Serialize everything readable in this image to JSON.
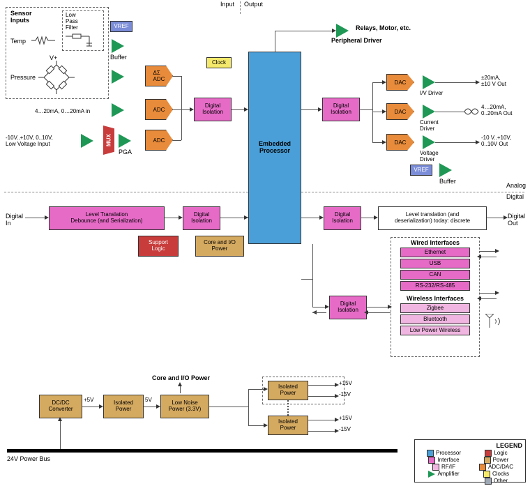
{
  "headings": {
    "input": "Input",
    "output": "Output",
    "sensor_inputs": "Sensor\nInputs",
    "low_pass_filter": "Low\nPass\nFilter",
    "temp": "Temp",
    "pressure": "Pressure",
    "vplus": "V+",
    "analog": "Analog",
    "digital": "Digital",
    "wired": "Wired Interfaces",
    "wireless": "Wireless Interfaces",
    "legend": "LEGEND"
  },
  "blocks": {
    "vref": "VREF",
    "buffer": "Buffer",
    "ds_adc": "ΔΣ\nADC",
    "adc": "ADC",
    "mux": "MUX",
    "pga": "PGA",
    "clock": "Clock",
    "digital_isolation": "Digital\nIsolation",
    "embedded_processor": "Embedded\nProcessor",
    "dac": "DAC",
    "iv_driver": "I/V Driver",
    "current_driver": "Current\nDriver",
    "voltage_driver": "Voltage\nDriver",
    "relays": "Relays, Motor, etc.",
    "peripheral_driver": "Peripheral Driver",
    "level_trans_in": "Level Translation\nDebounce (and Serialization)",
    "level_trans_out": "Level translation (and\ndeserialization) today: discrete",
    "support_logic": "Support\nLogic",
    "core_io_power": "Core and I/O\nPower",
    "ethernet": "Ethernet",
    "usb": "USB",
    "can": "CAN",
    "rs": "RS-232/RS-485",
    "zigbee": "Zigbee",
    "bluetooth": "Bluetooth",
    "low_power_wireless": "Low Power Wireless",
    "dcdc": "DC/DC\nConverter",
    "isolated_power": "Isolated\nPower",
    "low_noise_power": "Low Noise\nPower (3.3V)",
    "core_io_power_lbl": "Core and I/O Power"
  },
  "io_labels": {
    "input_range1": "4…20mA, 0…20mA in",
    "input_range2": "-10V..+10V, 0..10V,\nLow Voltage Input",
    "digital_in": "Digital\nIn",
    "digital_out": "Digital\nOut",
    "out_20ma": "±20mA,\n±10 V Out",
    "out_420ma": "4…20mA,\n0..20mA Out",
    "out_10v": "-10 V..+10V,\n0..10V Out",
    "plus5v": "+5V",
    "5v": "5V",
    "plus15v": "+15V",
    "minus15v": "-15V",
    "power_bus": "24V Power Bus"
  },
  "legend": {
    "processor": "Processor",
    "interface": "Interface",
    "rfif": "RF/IF",
    "amplifier": "Amplifier",
    "logic": "Logic",
    "power": "Power",
    "adcdac": "ADC/DAC",
    "clocks": "Clocks",
    "other": "Other"
  }
}
